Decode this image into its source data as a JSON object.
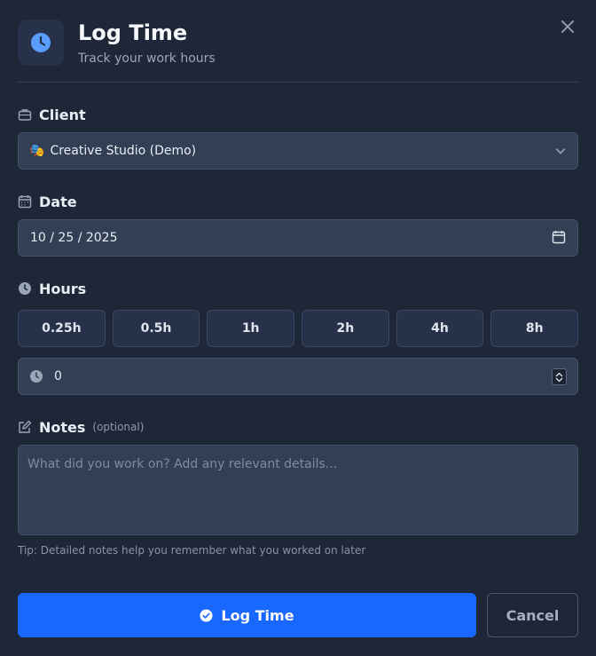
{
  "header": {
    "title": "Log Time",
    "subtitle": "Track your work hours",
    "icon": "clock-icon"
  },
  "client": {
    "label": "Client",
    "icon": "briefcase-icon",
    "selected_emoji": "🎭",
    "selected": "Creative Studio (Demo)"
  },
  "date": {
    "label": "Date",
    "icon": "calendar-icon",
    "value": "10 / 25 / 2025"
  },
  "hours": {
    "label": "Hours",
    "icon": "clock-icon",
    "presets": [
      "0.25h",
      "0.5h",
      "1h",
      "2h",
      "4h",
      "8h"
    ],
    "value": "0"
  },
  "notes": {
    "label": "Notes",
    "optional": "(optional)",
    "icon": "edit-icon",
    "placeholder": "What did you work on? Add any relevant details...",
    "tip": "Tip: Detailed notes help you remember what you worked on later"
  },
  "actions": {
    "submit": "Log Time",
    "cancel": "Cancel"
  },
  "colors": {
    "background": "#1e2738",
    "accent": "#1867ff",
    "field": "#323f54"
  }
}
